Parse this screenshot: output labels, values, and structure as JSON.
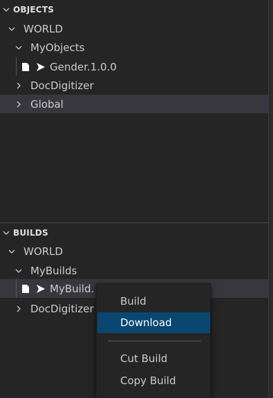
{
  "objects": {
    "header": "OBJECTS",
    "tree": {
      "world": "WORLD",
      "my_objects": "MyObjects",
      "gender": "Gender.1.0.0",
      "doc_digitizer": "DocDigitizer",
      "global": "Global"
    }
  },
  "builds": {
    "header": "BUILDS",
    "tree": {
      "world": "WORLD",
      "my_builds": "MyBuilds",
      "my_build": "MyBuild.",
      "doc_digitizer": "DocDigitizer"
    }
  },
  "context_menu": {
    "items": [
      {
        "label": "Build"
      },
      {
        "label": "Download"
      },
      {
        "label": "Cut Build"
      },
      {
        "label": "Copy Build"
      }
    ],
    "active_item": "Download"
  },
  "colors": {
    "background": "#252526",
    "row_highlight": "#37373d",
    "menu_active": "#094771",
    "text": "#cccccc"
  },
  "icons": [
    "chevron-down-icon",
    "chevron-right-icon",
    "file-icon",
    "play-icon"
  ]
}
